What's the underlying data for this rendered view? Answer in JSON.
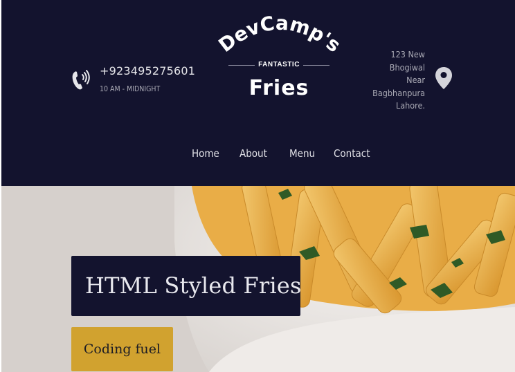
{
  "header": {
    "phone": "+923495275601",
    "hours": "10 AM - MIDNIGHT",
    "address_lines": [
      "123 New",
      "Bhogiwal",
      "Near",
      "Bagbhanpura",
      "Lahore."
    ],
    "icons": {
      "phone": "phone-icon",
      "location": "location-pin-icon"
    }
  },
  "logo": {
    "arc_text": "DevCamp's",
    "tagline": "FANTASTIC",
    "name": "Fries"
  },
  "nav": {
    "items": [
      {
        "label": "Home"
      },
      {
        "label": "About"
      },
      {
        "label": "Menu"
      },
      {
        "label": "Contact"
      }
    ]
  },
  "hero": {
    "title": "HTML Styled Fries",
    "cta_label": "Coding fuel"
  },
  "colors": {
    "header_bg": "#13132e",
    "accent": "#d1a22f",
    "text_light": "#e6e6ea",
    "text_muted": "#a9a9b4"
  }
}
